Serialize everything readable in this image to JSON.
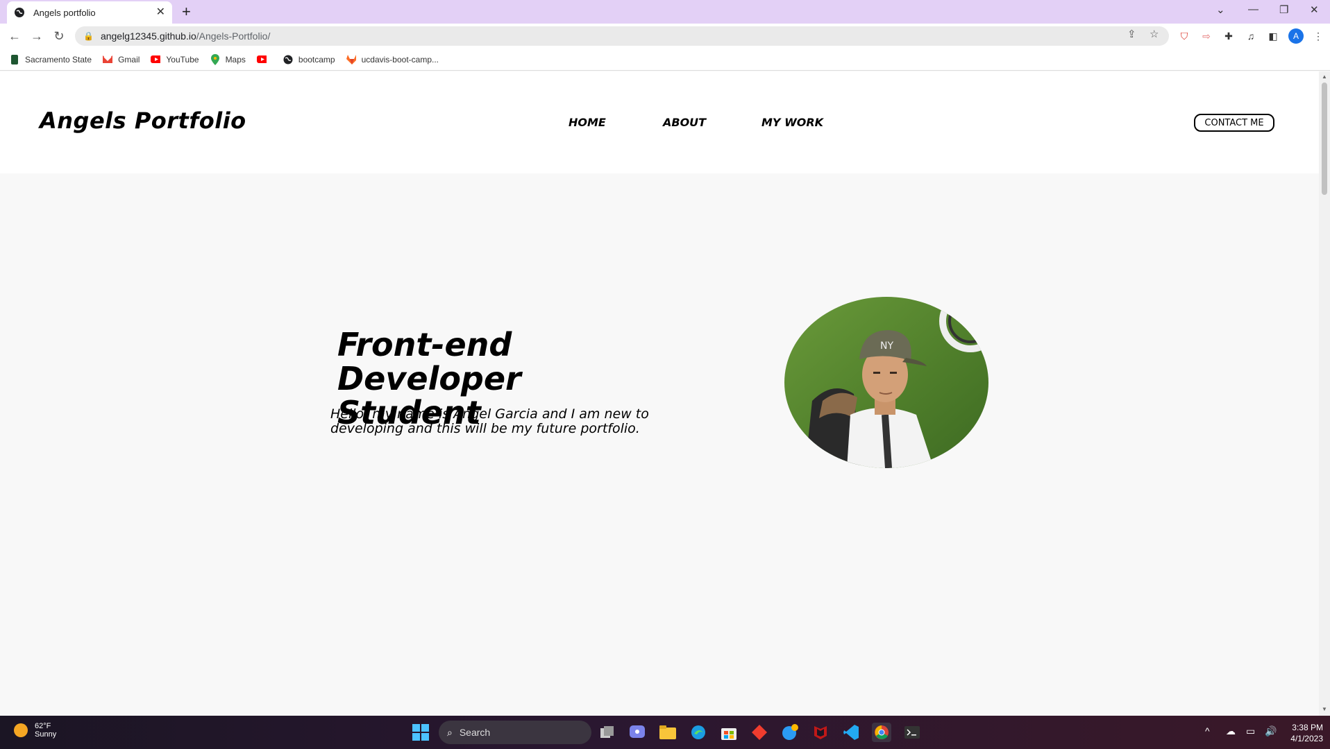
{
  "browser": {
    "tab_title": "Angels portfolio",
    "url_host": "angelg12345.github.io",
    "url_path": "/Angels-Portfolio/",
    "bookmarks": [
      {
        "label": "Sacramento State",
        "icon": "sac-state-icon"
      },
      {
        "label": "Gmail",
        "icon": "gmail-icon"
      },
      {
        "label": "YouTube",
        "icon": "youtube-icon"
      },
      {
        "label": "Maps",
        "icon": "maps-icon"
      },
      {
        "label": "",
        "icon": "youtube-icon"
      },
      {
        "label": "bootcamp",
        "icon": "globe-icon"
      },
      {
        "label": "ucdavis-boot-camp...",
        "icon": "gitlab-icon"
      }
    ],
    "profile_initial": "A"
  },
  "site": {
    "brand": "Angels Portfolio",
    "nav": [
      "HOME",
      "ABOUT",
      "MY WORK"
    ],
    "contact_label": "CONTACT ME",
    "hero_title_line1": "Front-end Developer",
    "hero_title_line2": "Student",
    "hero_text": "Hello, my name is Angel Garcia and I am new to developing and this will be my future portfolio."
  },
  "taskbar": {
    "temperature": "62°F",
    "condition": "Sunny",
    "search_label": "Search",
    "time": "3:38 PM",
    "date": "4/1/2023"
  },
  "colors": {
    "tab_strip": "#e3d0f6",
    "page_bg": "#f8f8f8",
    "accent": "#1a73e8"
  }
}
